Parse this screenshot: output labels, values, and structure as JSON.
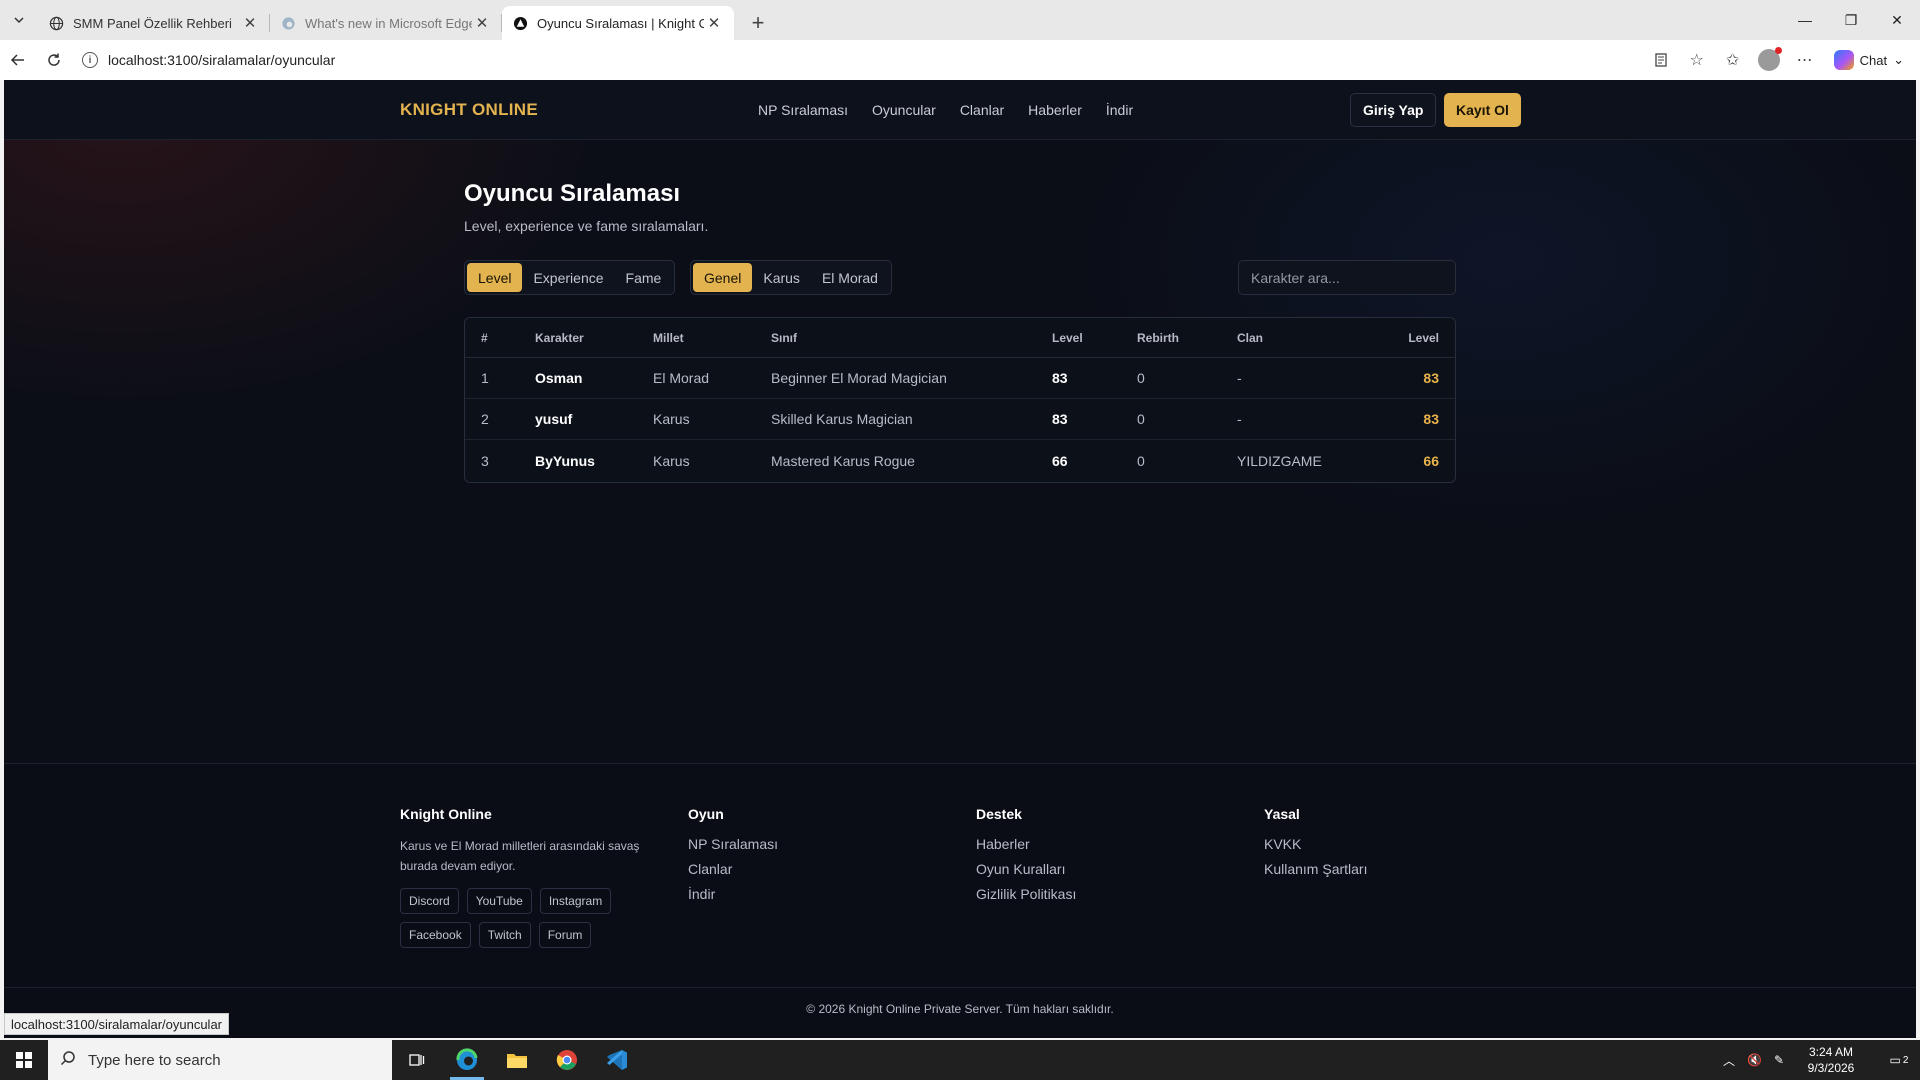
{
  "browser": {
    "tabs": [
      {
        "title": "SMM Panel Özellik Rehberi",
        "active": false
      },
      {
        "title": "What's new in Microsoft Edge",
        "active": false
      },
      {
        "title": "Oyuncu Sıralaması | Knight Online",
        "active": true
      }
    ],
    "url": "localhost:3100/siralamalar/oyuncular",
    "chat_label": "Chat",
    "status_url": "localhost:3100/siralamalar/oyuncular"
  },
  "site": {
    "logo": "KNIGHT ONLINE",
    "nav": [
      "NP Sıralaması",
      "Oyuncular",
      "Clanlar",
      "Haberler",
      "İndir"
    ],
    "login_label": "Giriş Yap",
    "register_label": "Kayıt Ol"
  },
  "main": {
    "title": "Oyuncu Sıralaması",
    "subtitle": "Level, experience ve fame sıralamaları.",
    "sort_tabs": [
      {
        "label": "Level",
        "active": true
      },
      {
        "label": "Experience",
        "active": false
      },
      {
        "label": "Fame",
        "active": false
      }
    ],
    "nation_tabs": [
      {
        "label": "Genel",
        "active": true
      },
      {
        "label": "Karus",
        "active": false
      },
      {
        "label": "El Morad",
        "active": false
      }
    ],
    "search_placeholder": "Karakter ara...",
    "table": {
      "headers": [
        "#",
        "Karakter",
        "Millet",
        "Sınıf",
        "Level",
        "Rebirth",
        "Clan",
        "Level"
      ],
      "rows": [
        {
          "rank": "1",
          "name": "Osman",
          "nation": "El Morad",
          "class": "Beginner El Morad Magician",
          "level": "83",
          "rebirth": "0",
          "clan": "-",
          "level2": "83"
        },
        {
          "rank": "2",
          "name": "yusuf",
          "nation": "Karus",
          "class": "Skilled Karus Magician",
          "level": "83",
          "rebirth": "0",
          "clan": "-",
          "level2": "83"
        },
        {
          "rank": "3",
          "name": "ByYunus",
          "nation": "Karus",
          "class": "Mastered Karus Rogue",
          "level": "66",
          "rebirth": "0",
          "clan": "YILDIZGAME",
          "level2": "66"
        }
      ]
    }
  },
  "footer": {
    "col1": {
      "title": "Knight Online",
      "desc": "Karus ve El Morad milletleri arasındaki savaş burada devam ediyor.",
      "tags_row1": [
        "Discord",
        "YouTube",
        "Instagram"
      ],
      "tags_row2": [
        "Facebook",
        "Twitch",
        "Forum"
      ]
    },
    "col2": {
      "title": "Oyun",
      "links": [
        "NP Sıralaması",
        "Clanlar",
        "İndir"
      ]
    },
    "col3": {
      "title": "Destek",
      "links": [
        "Haberler",
        "Oyun Kuralları",
        "Gizlilik Politikası"
      ]
    },
    "col4": {
      "title": "Yasal",
      "links": [
        "KVKK",
        "Kullanım Şartları"
      ]
    },
    "copyright": "© 2026 Knight Online Private Server. Tüm hakları saklıdır."
  },
  "taskbar": {
    "search_placeholder": "Type here to search",
    "time": "3:24 AM",
    "date": "9/3/2026",
    "notification_count": "2"
  },
  "colors": {
    "accent": "#e2b34e",
    "page_bg": "#0b0e17"
  }
}
